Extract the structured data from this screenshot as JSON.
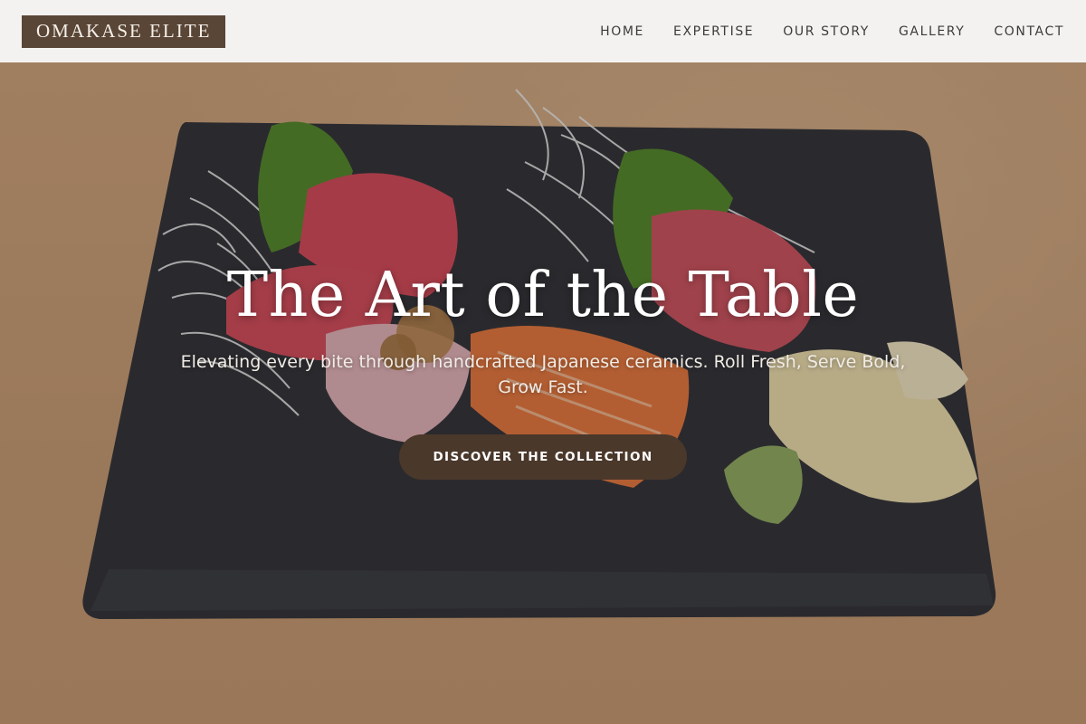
{
  "brand": {
    "name": "OMAKASE ELITE"
  },
  "nav": {
    "items": [
      {
        "label": "HOME"
      },
      {
        "label": "EXPERTISE"
      },
      {
        "label": "OUR STORY"
      },
      {
        "label": "GALLERY"
      },
      {
        "label": "CONTACT"
      }
    ]
  },
  "hero": {
    "title": "The Art of the Table",
    "subtitle": "Elevating every bite through handcrafted Japanese ceramics. Roll Fresh, Serve Bold, Grow Fast.",
    "cta_label": "DISCOVER THE COLLECTION"
  },
  "colors": {
    "header_bg": "#f4f2f0",
    "brand_bg": "#5a4636",
    "cta_bg": "#4a382b",
    "table_wood": "#c9a07a",
    "slate": "#2b3038"
  }
}
